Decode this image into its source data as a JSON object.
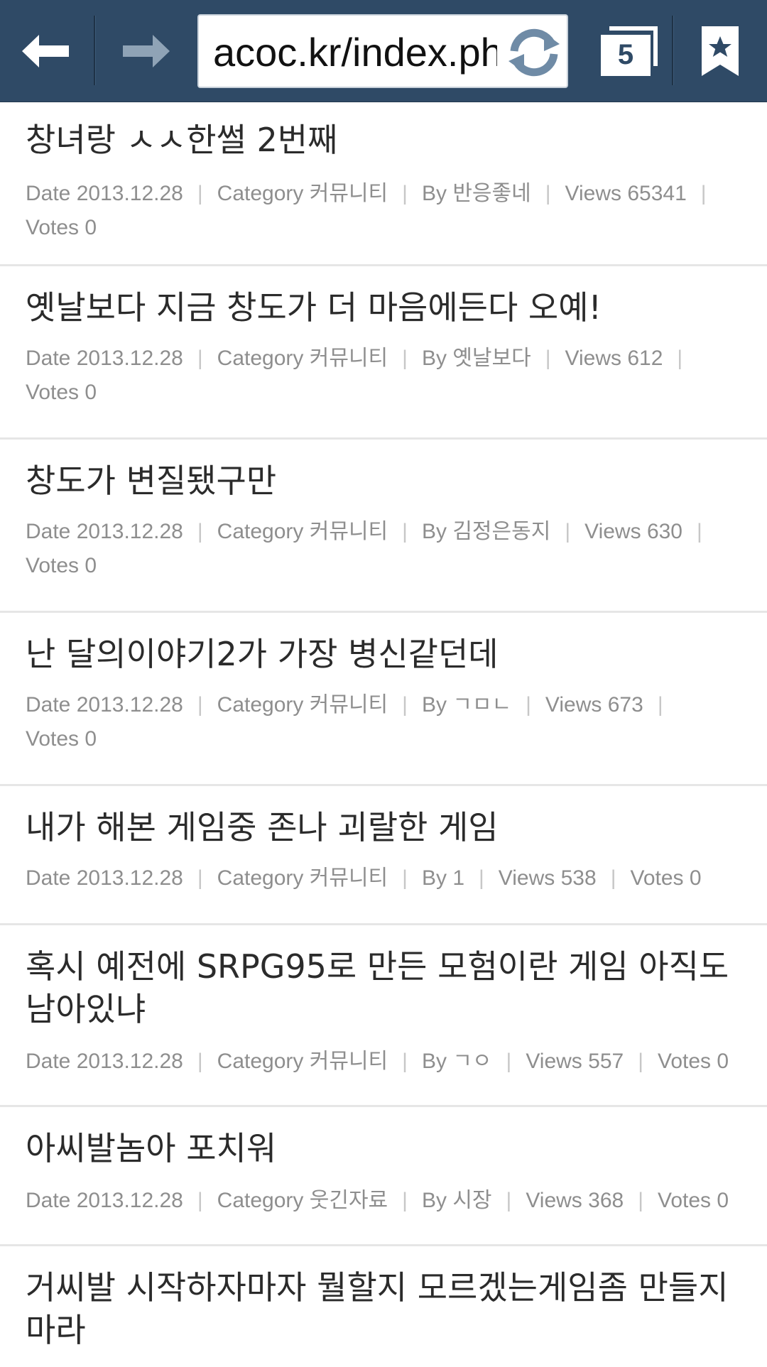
{
  "browser": {
    "url": "acoc.kr/index.php",
    "tab_count": "5",
    "colors": {
      "toolbar": "#2f4a66",
      "icon": "#ffffff",
      "icon_disabled": "#8fa3b6"
    }
  },
  "labels": {
    "date": "Date",
    "category": "Category",
    "by": "By",
    "views": "Views",
    "votes": "Votes"
  },
  "posts": [
    {
      "title": "창녀랑 ㅅㅅ한썰 2번째",
      "date": "2013.12.28",
      "category": "커뮤니티",
      "author": "반응좋네",
      "views": "65341",
      "votes": "0"
    },
    {
      "title": "옛날보다 지금 창도가 더 마음에든다 오예!",
      "date": "2013.12.28",
      "category": "커뮤니티",
      "author": "옛날보다",
      "views": "612",
      "votes": "0"
    },
    {
      "title": "창도가 변질됐구만",
      "date": "2013.12.28",
      "category": "커뮤니티",
      "author": "김정은동지",
      "views": "630",
      "votes": "0"
    },
    {
      "title": "난 달의이야기2가 가장 병신같던데",
      "date": "2013.12.28",
      "category": "커뮤니티",
      "author": "ㄱㅁㄴ",
      "views": "673",
      "votes": "0"
    },
    {
      "title": "내가 해본 게임중 존나 괴랄한 게임",
      "date": "2013.12.28",
      "category": "커뮤니티",
      "author": "1",
      "views": "538",
      "votes": "0"
    },
    {
      "title": "혹시 예전에 SRPG95로 만든 모험이란 게임 아직도 남아있냐",
      "date": "2013.12.28",
      "category": "커뮤니티",
      "author": "ㄱㅇ",
      "views": "557",
      "votes": "0"
    },
    {
      "title": "아씨발놈아 포치워",
      "date": "2013.12.28",
      "category": "웃긴자료",
      "author": "시장",
      "views": "368",
      "votes": "0"
    },
    {
      "title": "거씨발 시작하자마자 뭘할지 모르겠는게임좀 만들지마라"
    }
  ]
}
